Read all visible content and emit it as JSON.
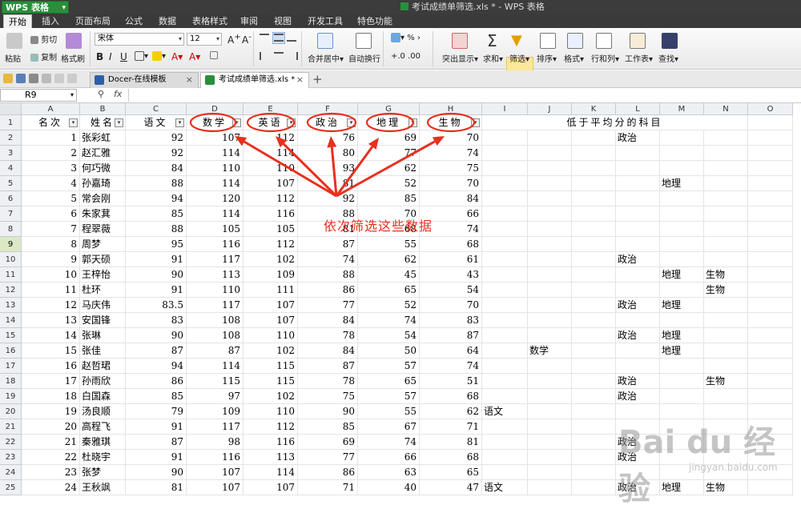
{
  "app": {
    "name": "WPS 表格",
    "window_title": "考试成绩单筛选.xls * - WPS 表格"
  },
  "menu": [
    "开始",
    "插入",
    "页面布局",
    "公式",
    "数据",
    "表格样式",
    "审阅",
    "视图",
    "开发工具",
    "特色功能"
  ],
  "ribbon": {
    "paste": "粘贴",
    "cut": "剪切",
    "copy": "复制",
    "format_painter": "格式刷",
    "font_name": "宋体",
    "font_size": "12",
    "bold": "B",
    "italic": "I",
    "underline": "U",
    "merge": "合并居中",
    "wrap": "自动换行",
    "percent": "%",
    "highlight": "突出显示",
    "sum": "求和",
    "filter": "筛选",
    "sort": "排序",
    "format": "格式",
    "rowcol": "行和列",
    "sheet": "工作表",
    "find": "查找"
  },
  "tabs": [
    {
      "label": "Docer-在线模板"
    },
    {
      "label": "考试成绩单筛选.xls *"
    }
  ],
  "formula_bar": {
    "cell_ref": "R9",
    "fx": "fx"
  },
  "sheet": {
    "columns": [
      "A",
      "B",
      "C",
      "D",
      "E",
      "F",
      "G",
      "H",
      "I",
      "J",
      "K",
      "L",
      "M",
      "N",
      "O"
    ],
    "headers": [
      "名次",
      "姓名",
      "语文",
      "数学",
      "英语",
      "政治",
      "地理",
      "生物"
    ],
    "note_header": "低于平均分的科目",
    "rows": [
      {
        "r": "2",
        "rank": "1",
        "name": "张彩虹",
        "yw": "92",
        "sx": "107",
        "yy": "112",
        "zz": "76",
        "dl": "69",
        "sw": "70",
        "I": "",
        "J": "",
        "L": "政治",
        "M": "",
        "N": ""
      },
      {
        "r": "3",
        "rank": "2",
        "name": "赵汇雅",
        "yw": "92",
        "sx": "114",
        "yy": "114",
        "zz": "80",
        "dl": "77",
        "sw": "74",
        "I": "",
        "J": "",
        "L": "",
        "M": "",
        "N": ""
      },
      {
        "r": "4",
        "rank": "3",
        "name": "何巧微",
        "yw": "84",
        "sx": "110",
        "yy": "110",
        "zz": "93",
        "dl": "62",
        "sw": "75",
        "I": "",
        "J": "",
        "L": "",
        "M": "",
        "N": ""
      },
      {
        "r": "5",
        "rank": "4",
        "name": "孙嘉琦",
        "yw": "88",
        "sx": "114",
        "yy": "107",
        "zz": "81",
        "dl": "52",
        "sw": "70",
        "I": "",
        "J": "",
        "L": "",
        "M": "地理",
        "N": ""
      },
      {
        "r": "6",
        "rank": "5",
        "name": "常会刚",
        "yw": "94",
        "sx": "120",
        "yy": "112",
        "zz": "92",
        "dl": "85",
        "sw": "84",
        "I": "",
        "J": "",
        "L": "",
        "M": "",
        "N": ""
      },
      {
        "r": "7",
        "rank": "6",
        "name": "朱家萁",
        "yw": "85",
        "sx": "114",
        "yy": "116",
        "zz": "88",
        "dl": "70",
        "sw": "66",
        "I": "",
        "J": "",
        "L": "",
        "M": "",
        "N": ""
      },
      {
        "r": "8",
        "rank": "7",
        "name": "程翠薇",
        "yw": "88",
        "sx": "105",
        "yy": "105",
        "zz": "81",
        "dl": "68",
        "sw": "74",
        "I": "",
        "J": "",
        "L": "",
        "M": "",
        "N": ""
      },
      {
        "r": "9",
        "rank": "8",
        "name": "周梦",
        "yw": "95",
        "sx": "116",
        "yy": "112",
        "zz": "87",
        "dl": "55",
        "sw": "68",
        "I": "",
        "J": "",
        "L": "",
        "M": "",
        "N": ""
      },
      {
        "r": "10",
        "rank": "9",
        "name": "郭天硕",
        "yw": "91",
        "sx": "117",
        "yy": "102",
        "zz": "74",
        "dl": "62",
        "sw": "61",
        "I": "",
        "J": "",
        "L": "政治",
        "M": "",
        "N": ""
      },
      {
        "r": "11",
        "rank": "10",
        "name": "王梓怡",
        "yw": "90",
        "sx": "113",
        "yy": "109",
        "zz": "88",
        "dl": "45",
        "sw": "43",
        "I": "",
        "J": "",
        "L": "",
        "M": "地理",
        "N": "生物"
      },
      {
        "r": "12",
        "rank": "11",
        "name": "杜环",
        "yw": "91",
        "sx": "110",
        "yy": "111",
        "zz": "86",
        "dl": "65",
        "sw": "54",
        "I": "",
        "J": "",
        "L": "",
        "M": "",
        "N": "生物"
      },
      {
        "r": "13",
        "rank": "12",
        "name": "马庆伟",
        "yw": "83.5",
        "sx": "117",
        "yy": "107",
        "zz": "77",
        "dl": "52",
        "sw": "70",
        "I": "",
        "J": "",
        "L": "政治",
        "M": "地理",
        "N": ""
      },
      {
        "r": "14",
        "rank": "13",
        "name": "安国锋",
        "yw": "83",
        "sx": "108",
        "yy": "107",
        "zz": "84",
        "dl": "74",
        "sw": "83",
        "I": "",
        "J": "",
        "L": "",
        "M": "",
        "N": ""
      },
      {
        "r": "15",
        "rank": "14",
        "name": "张琳",
        "yw": "90",
        "sx": "108",
        "yy": "110",
        "zz": "78",
        "dl": "54",
        "sw": "87",
        "I": "",
        "J": "",
        "L": "政治",
        "M": "地理",
        "N": ""
      },
      {
        "r": "16",
        "rank": "15",
        "name": "张佳",
        "yw": "87",
        "sx": "87",
        "yy": "102",
        "zz": "84",
        "dl": "50",
        "sw": "64",
        "I": "",
        "J": "数学",
        "L": "",
        "M": "地理",
        "N": ""
      },
      {
        "r": "17",
        "rank": "16",
        "name": "赵哲珺",
        "yw": "94",
        "sx": "114",
        "yy": "115",
        "zz": "87",
        "dl": "57",
        "sw": "74",
        "I": "",
        "J": "",
        "L": "",
        "M": "",
        "N": ""
      },
      {
        "r": "18",
        "rank": "17",
        "name": "孙雨欣",
        "yw": "86",
        "sx": "115",
        "yy": "115",
        "zz": "78",
        "dl": "65",
        "sw": "51",
        "I": "",
        "J": "",
        "L": "政治",
        "M": "",
        "N": "生物"
      },
      {
        "r": "19",
        "rank": "18",
        "name": "白国森",
        "yw": "85",
        "sx": "97",
        "yy": "102",
        "zz": "75",
        "dl": "57",
        "sw": "68",
        "I": "",
        "J": "",
        "L": "政治",
        "M": "",
        "N": ""
      },
      {
        "r": "20",
        "rank": "19",
        "name": "汤良顺",
        "yw": "79",
        "sx": "109",
        "yy": "110",
        "zz": "90",
        "dl": "55",
        "sw": "62",
        "I": "语文",
        "J": "",
        "L": "",
        "M": "",
        "N": ""
      },
      {
        "r": "21",
        "rank": "20",
        "name": "高程飞",
        "yw": "91",
        "sx": "117",
        "yy": "112",
        "zz": "85",
        "dl": "67",
        "sw": "71",
        "I": "",
        "J": "",
        "L": "",
        "M": "",
        "N": ""
      },
      {
        "r": "22",
        "rank": "21",
        "name": "秦雅琪",
        "yw": "87",
        "sx": "98",
        "yy": "116",
        "zz": "69",
        "dl": "74",
        "sw": "81",
        "I": "",
        "J": "",
        "L": "政治",
        "M": "",
        "N": ""
      },
      {
        "r": "23",
        "rank": "22",
        "name": "杜晓宇",
        "yw": "91",
        "sx": "116",
        "yy": "113",
        "zz": "77",
        "dl": "66",
        "sw": "68",
        "I": "",
        "J": "",
        "L": "政治",
        "M": "",
        "N": ""
      },
      {
        "r": "24",
        "rank": "23",
        "name": "张梦",
        "yw": "90",
        "sx": "107",
        "yy": "114",
        "zz": "86",
        "dl": "63",
        "sw": "65",
        "I": "",
        "J": "",
        "L": "",
        "M": "",
        "N": ""
      },
      {
        "r": "25",
        "rank": "24",
        "name": "王秋飒",
        "yw": "81",
        "sx": "107",
        "yy": "107",
        "zz": "71",
        "dl": "40",
        "sw": "47",
        "I": "语文",
        "J": "",
        "L": "政治",
        "M": "地理",
        "N": "生物"
      }
    ]
  },
  "annotation": {
    "text": "依次筛选这些数据",
    "color": "#e8301e"
  },
  "watermark": {
    "text": "Bai du 经验",
    "sub": "jingyan.baidu.com"
  }
}
